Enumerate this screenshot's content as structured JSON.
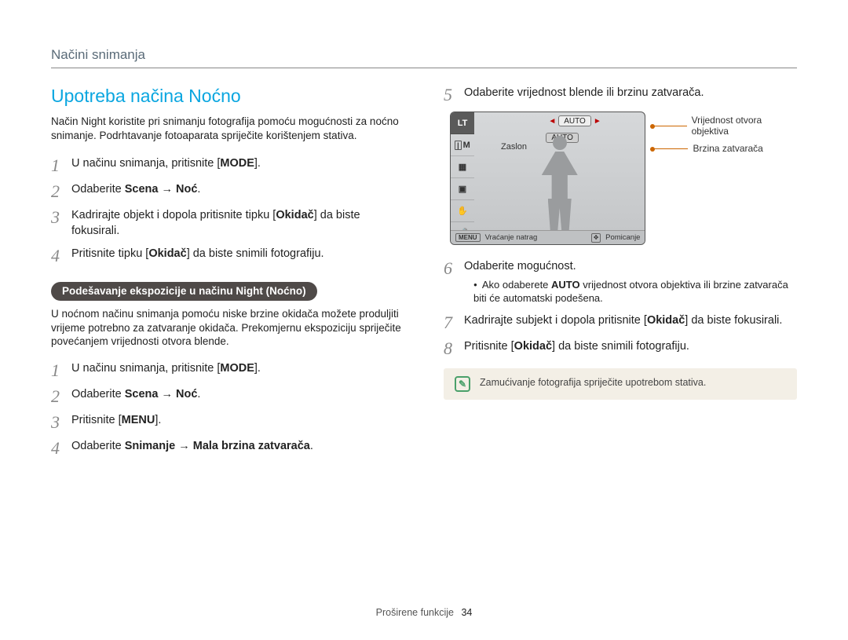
{
  "header": {
    "section": "Načini snimanja"
  },
  "title": "Upotreba načina Noćno",
  "intro": "Način Night koristite pri snimanju fotografija pomoću mogućnosti za noćno snimanje. Podrhtavanje fotoaparata spriječite korištenjem stativa.",
  "stepsA": [
    {
      "n": "1",
      "pre": "U načinu snimanja, pritisnite [",
      "kbd": "MODE",
      "post": "]."
    },
    {
      "n": "2",
      "pre": "Odaberite ",
      "bold": "Scena → Noć",
      "post": "."
    },
    {
      "n": "3",
      "pre": "Kadrirajte objekt i dopola pritisnite tipku [",
      "kbd": "Okidač",
      "post": "] da biste fokusirali."
    },
    {
      "n": "4",
      "pre": "Pritisnite tipku [",
      "kbd": "Okidač",
      "post": "] da biste snimili fotografiju."
    }
  ],
  "pill": "Podešavanje ekspozicije u načinu Night (Noćno)",
  "subIntro": "U noćnom načinu snimanja pomoću niske brzine okidača možete produljiti vrijeme potrebno za zatvaranje okidača. Prekomjernu ekspoziciju spriječite povećanjem vrijednosti otvora blende.",
  "stepsB": [
    {
      "n": "1",
      "pre": "U načinu snimanja, pritisnite [",
      "kbd": "MODE",
      "post": "]."
    },
    {
      "n": "2",
      "pre": "Odaberite ",
      "bold": "Scena → Noć",
      "post": "."
    },
    {
      "n": "3",
      "pre": "Pritisnite [",
      "kbd": "MENU",
      "post": "]."
    },
    {
      "n": "4",
      "pre": "Odaberite ",
      "bold": "Snimanje → Mala brzina zatvarača",
      "post": "."
    }
  ],
  "stepsC": [
    {
      "n": "5",
      "text": "Odaberite vrijednost blende ili brzinu zatvarača."
    },
    {
      "n": "6",
      "text": "Odaberite mogućnost.",
      "sub": "Ako odaberete AUTO vrijednost otvora objektiva ili brzine zatvarača biti će automatski podešena.",
      "subBold": "AUTO"
    },
    {
      "n": "7",
      "pre": "Kadrirajte subjekt i dopola pritisnite [",
      "kbd": "Okidač",
      "post": "] da biste fokusirali."
    },
    {
      "n": "8",
      "pre": "Pritisnite [",
      "kbd": "Okidač",
      "post": "] da biste snimili fotografiju."
    }
  ],
  "screen": {
    "autoTop": "AUTO",
    "autoBottom": "AUTO",
    "zaslon": "Zaslon",
    "menu": "MENU",
    "back": "Vraćanje natrag",
    "move": "Pomicanje",
    "lt": "LT",
    "m": "M"
  },
  "callouts": {
    "aperture": "Vrijednost otvora objektiva",
    "shutter": "Brzina zatvarača"
  },
  "note": "Zamućivanje fotografija spriječite upotrebom stativa.",
  "footer": {
    "label": "Proširene funkcije",
    "page": "34"
  }
}
